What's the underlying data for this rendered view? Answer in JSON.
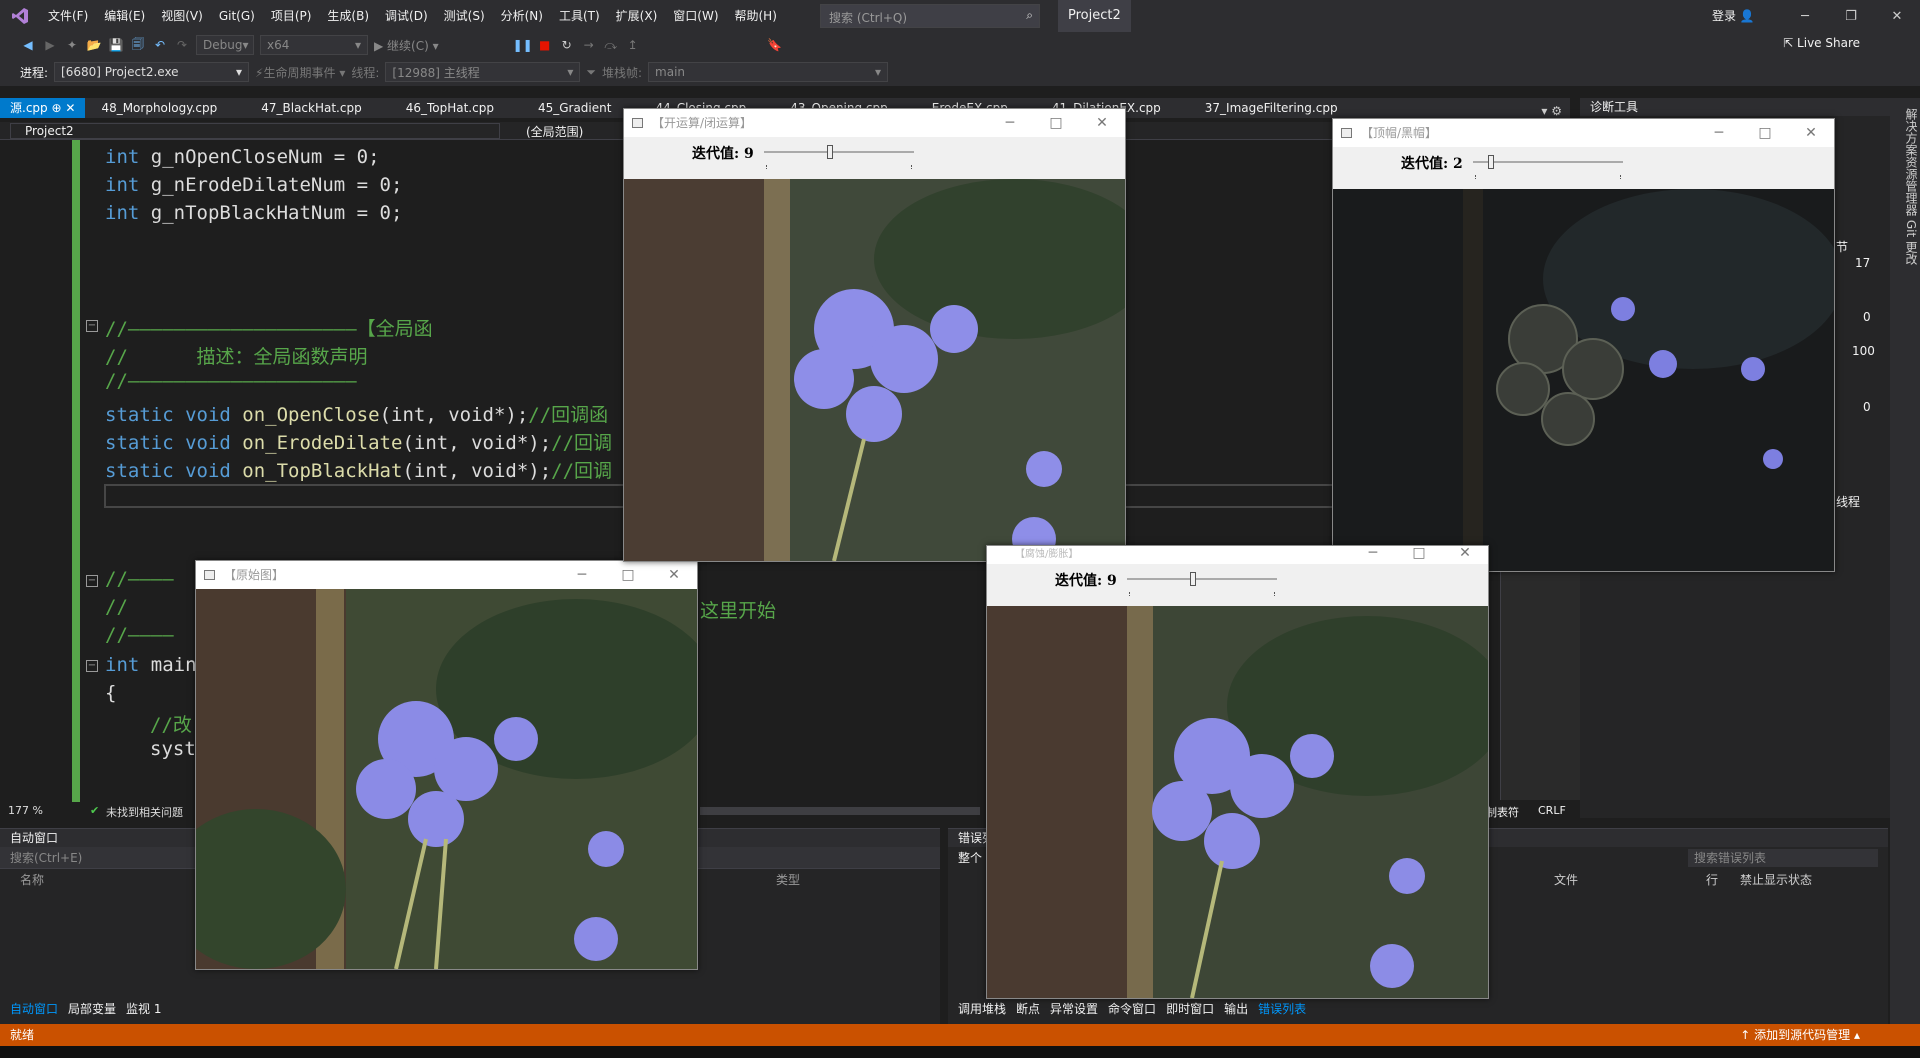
{
  "menubar": {
    "items": [
      "文件(F)",
      "编辑(E)",
      "视图(V)",
      "Git(G)",
      "项目(P)",
      "生成(B)",
      "调试(D)",
      "测试(S)",
      "分析(N)",
      "工具(T)",
      "扩展(X)",
      "窗口(W)",
      "帮助(H)"
    ],
    "search_placeholder": "搜索 (Ctrl+Q)",
    "project": "Project2",
    "login": "登录"
  },
  "toolbar": {
    "config": "Debug",
    "platform": "x64",
    "continue": "继续(C)",
    "live_share": "Live Share"
  },
  "toolbar2": {
    "process_label": "进程:",
    "process_value": "[6680] Project2.exe",
    "lifecycle": "生命周期事件",
    "thread_label": "线程:",
    "thread_value": "[12988] 主线程",
    "stack_label": "堆栈帧:",
    "stack_value": "main"
  },
  "tabs": [
    "源.cpp",
    "48_Morphology.cpp",
    "47_BlackHat.cpp",
    "46_TopHat.cpp",
    "45_Gradient",
    "44_Closing.cpp",
    "43_Opening.cpp",
    "ErodeEX.cpp",
    "41_DilationEX.cpp",
    "37_ImageFiltering.cpp"
  ],
  "navbar": {
    "project": "Project2",
    "scope": "(全局范围)"
  },
  "code": {
    "l1a": "int",
    "l1b": " g_nOpenCloseNum = 0;",
    "l2a": "int",
    "l2b": " g_nErodeDilateNum = 0;",
    "l3a": "int",
    "l3b": " g_nTopBlackHatNum = 0;",
    "l4": "//————————————————————【全局函",
    "l5": "//      描述：全局函数声明",
    "l6": "//————————————————————",
    "f1k": "static void",
    "f1n": " on_OpenClose",
    "f1p": "(int, void*);",
    "f1c": "//回调函",
    "f2k": "static void",
    "f2n": " on_ErodeDilate",
    "f2p": "(int, void*);",
    "f2c": "//回调",
    "f3k": "static void",
    "f3n": " on_TopBlackHat",
    "f3p": "(int, void*);",
    "f3c": "//回调",
    "m1": "//————",
    "m2": "//",
    "m2b": "这里开始",
    "m3": "//————",
    "main_kw": "int",
    "main_fn": " main",
    "brace": "{",
    "c1": "//改",
    "c2": "syst"
  },
  "statusline": {
    "zoom": "177 %",
    "issues": "未找到相关问题"
  },
  "autos": {
    "title": "自动窗口",
    "search": "搜索(Ctrl+E)",
    "col_name": "名称",
    "col_type": "类型",
    "tabs": [
      "自动窗口",
      "局部变量",
      "监视 1"
    ]
  },
  "errors": {
    "title": "错误列",
    "scope": "整个",
    "search": "搜索错误列表",
    "cols": [
      "文件",
      "行",
      "禁止显示状态"
    ],
    "tabs": [
      "调用堆栈",
      "断点",
      "异常设置",
      "命令窗口",
      "即时窗口",
      "输出",
      "错误列表"
    ],
    "crlf": "CRLF",
    "tabs_label": "制表符"
  },
  "diag": {
    "title": "诊断工具",
    "v1": "17",
    "v2": "0",
    "v3": "100",
    "v4": "0",
    "section": "节",
    "thread": "线程"
  },
  "rightrail": "解决方案资源管理器  Git 更改",
  "status": {
    "ready": "就绪",
    "source_control": "添加到源代码管理"
  },
  "windows": {
    "open_close": {
      "title": "【开运算/闭运算】",
      "label": "迭代值: 9",
      "value": 9
    },
    "top_black": {
      "title": "【顶帽/黑帽】",
      "label": "迭代值: 2",
      "value": 2
    },
    "original": {
      "title": "【原始图】"
    },
    "erode_dilate": {
      "title": "【腐蚀/膨胀】",
      "label": "迭代值: 9",
      "value": 9
    }
  }
}
